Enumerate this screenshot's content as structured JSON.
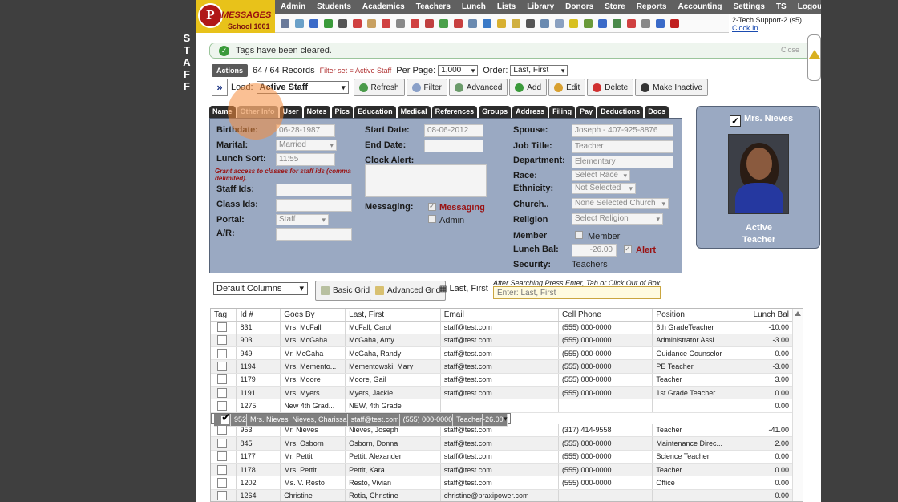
{
  "side_label": [
    "S",
    "T",
    "A",
    "F",
    "F"
  ],
  "logo": {
    "letter": "P",
    "line1": "MESSAGES",
    "line2": "School 1001"
  },
  "menu": [
    "Admin",
    "Students",
    "Academics",
    "Teachers",
    "Lunch",
    "Lists",
    "Library",
    "Donors",
    "Store",
    "Reports",
    "Accounting",
    "Settings",
    "TS",
    "Logout"
  ],
  "toolbar_icons": [
    "search-icon",
    "calendar-icon",
    "at-icon",
    "chat-icon",
    "phone-icon",
    "speaker-icon",
    "document-icon",
    "calendar-red-icon",
    "megaphone-icon",
    "user-red-icon",
    "people-icon",
    "money-icon",
    "alert-user-icon",
    "id-card-icon",
    "book-icon",
    "broom-icon",
    "mail-icon",
    "person-icon",
    "clock-icon",
    "grid-icon",
    "barcode-icon",
    "receipt-icon",
    "tax-icon",
    "cash-icon",
    "pdf-icon",
    "drive-icon",
    "help-icon",
    "power-icon"
  ],
  "user": {
    "name": "2-Tech Support-2 (s5)",
    "clock_in": "Clock In"
  },
  "message": {
    "text": "Tags have been cleared.",
    "close": "Close"
  },
  "records": {
    "actions": "Actions",
    "count": "64 / 64 Records",
    "filter": "Filter set = Active Staff",
    "per_page_label": "Per Page:",
    "per_page": "1,000",
    "order_label": "Order:",
    "order": "Last, First"
  },
  "load": {
    "label": "Load:",
    "value": "Active Staff"
  },
  "buttons": {
    "refresh": "Refresh",
    "filter": "Filter",
    "advanced": "Advanced",
    "add": "Add",
    "edit": "Edit",
    "delete": "Delete",
    "make_inactive": "Make Inactive"
  },
  "tabs": [
    "Name",
    "Other Info",
    "User",
    "Notes",
    "Pics",
    "Education",
    "Medical",
    "References",
    "Groups",
    "Address",
    "Filing",
    "Pay",
    "Deductions",
    "Docs"
  ],
  "active_tab": "Other Info",
  "info": {
    "birthdate_label": "Birthdate:",
    "birthdate": "06-28-1987",
    "marital_label": "Marital:",
    "marital": "Married",
    "lunch_sort_label": "Lunch Sort:",
    "lunch_sort": "11:55",
    "grant_note": "Grant access to classes for staff ids (comma delimited).",
    "staff_ids_label": "Staff Ids:",
    "class_ids_label": "Class Ids:",
    "portal_label": "Portal:",
    "portal": "Staff",
    "ar_label": "A/R:",
    "start_label": "Start Date:",
    "start": "08-06-2012",
    "end_label": "End Date:",
    "clock_alert_label": "Clock Alert:",
    "messaging_label": "Messaging:",
    "messaging_opt": "Messaging",
    "admin_opt": "Admin",
    "spouse_label": "Spouse:",
    "spouse": "Joseph - 407-925-8876",
    "job_label": "Job Title:",
    "job": "Teacher",
    "dept_label": "Department:",
    "dept": "Elementary",
    "race_label": "Race:",
    "race": "Select Race",
    "eth_label": "Ethnicity:",
    "eth": "Not Selected",
    "church_label": "Church..",
    "church": "None Selected Church",
    "religion_label": "Religion",
    "religion": "Select Religion",
    "member_label": "Member",
    "member_opt": "Member",
    "lunch_bal_label": "Lunch Bal:",
    "lunch_bal": "-26.00",
    "alert": "Alert",
    "security_label": "Security:",
    "security": "Teachers"
  },
  "card": {
    "name": "Mrs. Nieves",
    "status": "Active",
    "role": "Teacher"
  },
  "grid_controls": {
    "columns": "Default Columns",
    "basic": "Basic Grid",
    "advanced": "Advanced Grid",
    "sort": "Last, First",
    "hint": "After Searching Press Enter, Tab or Click Out of Box",
    "search_placeholder": "Enter: Last, First"
  },
  "columns": [
    "Tag",
    "Id #",
    "Goes By",
    "Last, First",
    "Email",
    "Cell Phone",
    "Position",
    "Lunch Bal"
  ],
  "rows": [
    {
      "tag": false,
      "id": "831",
      "goes_by": "Mrs. McFall",
      "name": "McFall, Carol",
      "email": "staff@test.com",
      "phone": "(555) 000-0000",
      "position": "6th GradeTeacher",
      "bal": "-10.00"
    },
    {
      "tag": false,
      "id": "903",
      "goes_by": "Mrs. McGaha",
      "name": "McGaha, Amy",
      "email": "staff@test.com",
      "phone": "(555) 000-0000",
      "position": "Administrator Assi...",
      "bal": "-3.00"
    },
    {
      "tag": false,
      "id": "949",
      "goes_by": "Mr. McGaha",
      "name": "McGaha, Randy",
      "email": "staff@test.com",
      "phone": "(555) 000-0000",
      "position": "Guidance Counselor",
      "bal": "0.00"
    },
    {
      "tag": false,
      "id": "1194",
      "goes_by": "Mrs. Memento...",
      "name": "Mementowski, Mary",
      "email": "staff@test.com",
      "phone": "(555) 000-0000",
      "position": "PE Teacher",
      "bal": "-3.00"
    },
    {
      "tag": false,
      "id": "1179",
      "goes_by": "Mrs. Moore",
      "name": "Moore, Gail",
      "email": "staff@test.com",
      "phone": "(555) 000-0000",
      "position": "Teacher",
      "bal": "3.00"
    },
    {
      "tag": false,
      "id": "1191",
      "goes_by": "Mrs. Myers",
      "name": "Myers, Jackie",
      "email": "staff@test.com",
      "phone": "(555) 000-0000",
      "position": "1st Grade Teacher",
      "bal": "0.00"
    },
    {
      "tag": false,
      "id": "1275",
      "goes_by": "New 4th Grad...",
      "name": "NEW, 4th Grade",
      "email": "",
      "phone": "",
      "position": "",
      "bal": "0.00"
    },
    {
      "tag": true,
      "id": "952",
      "goes_by": "Mrs. Nieves",
      "name": "Nieves, Charissa",
      "email": "staff@test.com",
      "phone": "(555) 000-0000",
      "position": "Teacher",
      "bal": "-26.00"
    },
    {
      "tag": false,
      "id": "953",
      "goes_by": "Mr. Nieves",
      "name": "Nieves, Joseph",
      "email": "staff@test.com",
      "phone": "(317) 414-9558",
      "position": "Teacher",
      "bal": "-41.00"
    },
    {
      "tag": false,
      "id": "845",
      "goes_by": "Mrs. Osborn",
      "name": "Osborn, Donna",
      "email": "staff@test.com",
      "phone": "(555) 000-0000",
      "position": "Maintenance Direc...",
      "bal": "2.00"
    },
    {
      "tag": false,
      "id": "1177",
      "goes_by": "Mr. Pettit",
      "name": "Pettit, Alexander",
      "email": "staff@test.com",
      "phone": "(555) 000-0000",
      "position": "Science Teacher",
      "bal": "0.00"
    },
    {
      "tag": false,
      "id": "1178",
      "goes_by": "Mrs. Pettit",
      "name": "Pettit, Kara",
      "email": "staff@test.com",
      "phone": "(555) 000-0000",
      "position": "Teacher",
      "bal": "0.00"
    },
    {
      "tag": false,
      "id": "1202",
      "goes_by": "Ms. V. Resto",
      "name": "Resto, Vivian",
      "email": "staff@test.com",
      "phone": "(555) 000-0000",
      "position": "Office",
      "bal": "0.00"
    },
    {
      "tag": false,
      "id": "1264",
      "goes_by": "Christine",
      "name": "Rotia, Christine",
      "email": "christine@praxipower.com",
      "phone": "",
      "position": "",
      "bal": "0.00"
    }
  ]
}
